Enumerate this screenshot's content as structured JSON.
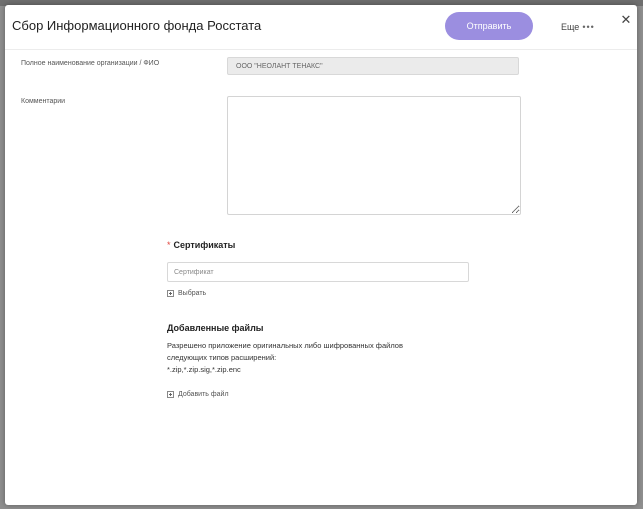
{
  "modal": {
    "title": "Сбор Информационного фонда Росстата",
    "send_label": "Отправить",
    "more_label": "Еще",
    "more_dots": "•••",
    "close_glyph": "✕"
  },
  "form": {
    "org_label": "Полное наименование организации / ФИО",
    "org_value": "ООО \"НЕОЛАНТ ТЕНАКС\"",
    "comment_label": "Комментарии",
    "comment_value": ""
  },
  "certificates": {
    "required_mark": "*",
    "title": "Сертификаты",
    "placeholder": "Сертификат",
    "select_label": "Выбрать"
  },
  "files": {
    "title": "Добавленные файлы",
    "desc_line1": "Разрешено приложение оригинальных либо шифрованных файлов",
    "desc_line2": "следующих типов расширений:",
    "desc_line3": "*.zip,*.zip.sig,*.zip.enc",
    "add_label": "Добавить файл"
  },
  "colors": {
    "accent": "#9b8ee0",
    "required": "#e0443c",
    "backdrop": "#8f8f8f"
  },
  "icons": {
    "close": "close-icon",
    "more": "more-dots-icon",
    "add": "plus-square-icon"
  }
}
